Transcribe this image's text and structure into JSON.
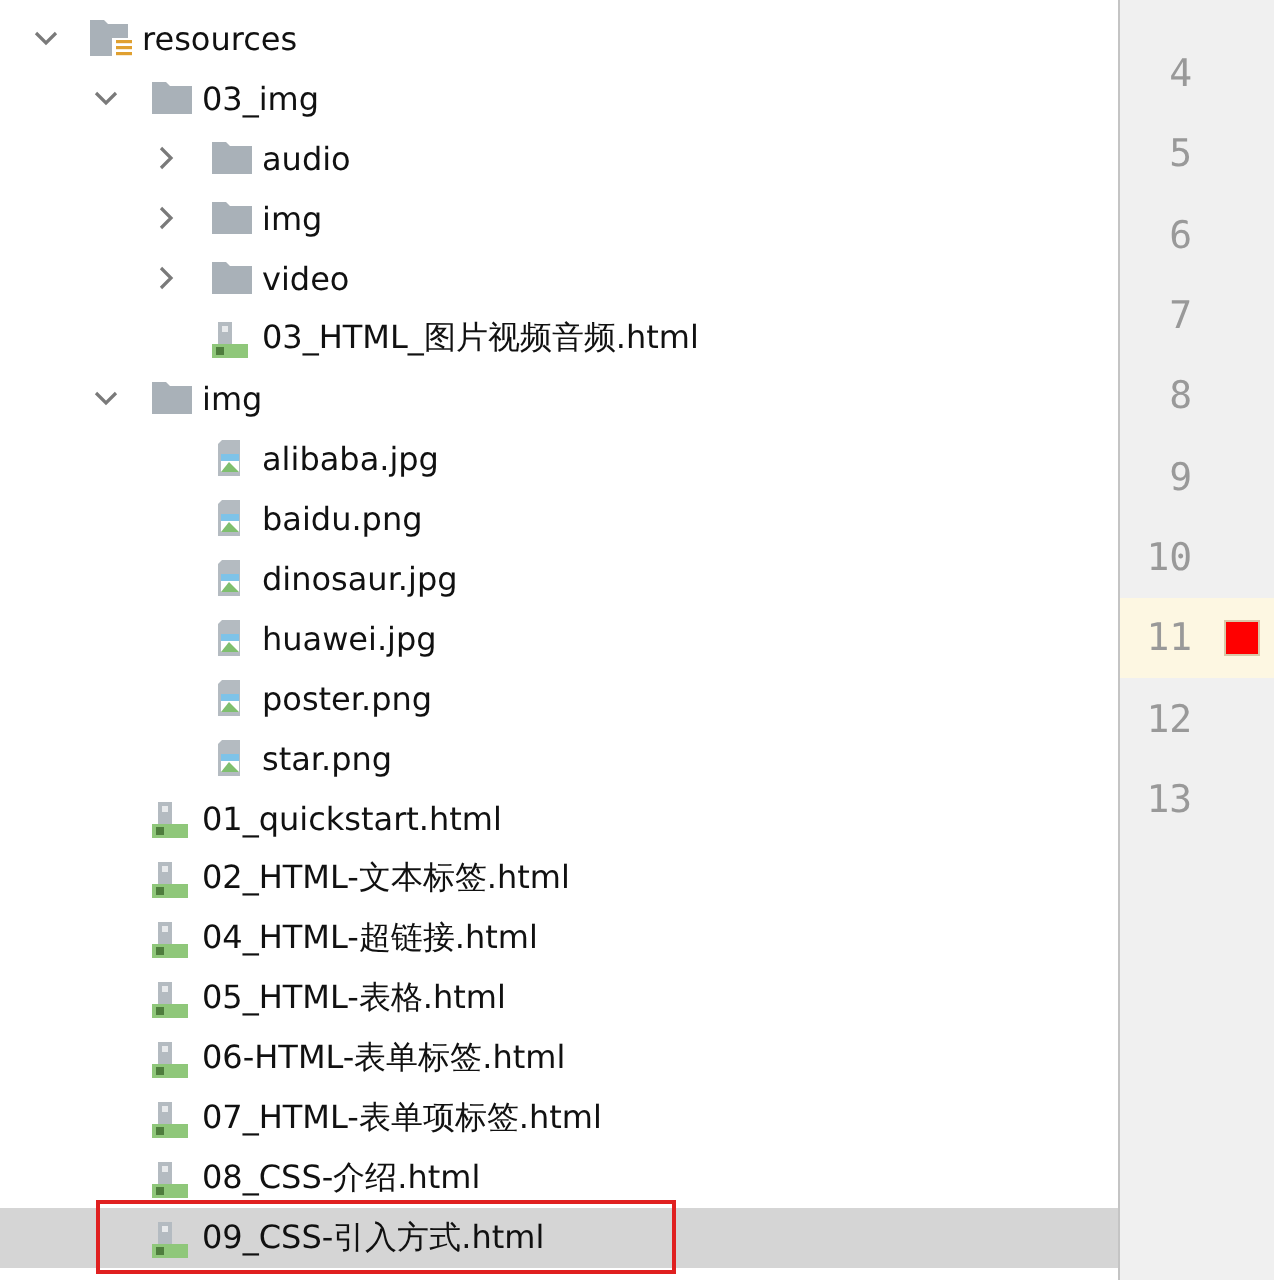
{
  "tree": [
    {
      "name": "resources",
      "kind": "module",
      "expanded": true,
      "selected": false,
      "children": [
        {
          "name": "03_img",
          "kind": "folder",
          "expanded": true,
          "selected": false,
          "children": [
            {
              "name": "audio",
              "kind": "folder",
              "expanded": false,
              "selected": false
            },
            {
              "name": "img",
              "kind": "folder",
              "expanded": false,
              "selected": false
            },
            {
              "name": "video",
              "kind": "folder",
              "expanded": false,
              "selected": false
            },
            {
              "name": "03_HTML_图片视频音频.html",
              "kind": "html",
              "selected": false
            }
          ]
        },
        {
          "name": "img",
          "kind": "folder",
          "expanded": true,
          "selected": false,
          "children": [
            {
              "name": "alibaba.jpg",
              "kind": "image",
              "selected": false
            },
            {
              "name": "baidu.png",
              "kind": "image",
              "selected": false
            },
            {
              "name": "dinosaur.jpg",
              "kind": "image",
              "selected": false
            },
            {
              "name": "huawei.jpg",
              "kind": "image",
              "selected": false
            },
            {
              "name": "poster.png",
              "kind": "image",
              "selected": false
            },
            {
              "name": "star.png",
              "kind": "image",
              "selected": false
            }
          ]
        },
        {
          "name": "01_quickstart.html",
          "kind": "html",
          "selected": false
        },
        {
          "name": "02_HTML-文本标签.html",
          "kind": "html",
          "selected": false
        },
        {
          "name": "04_HTML-超链接.html",
          "kind": "html",
          "selected": false
        },
        {
          "name": "05_HTML-表格.html",
          "kind": "html",
          "selected": false
        },
        {
          "name": "06-HTML-表单标签.html",
          "kind": "html",
          "selected": false
        },
        {
          "name": "07_HTML-表单项标签.html",
          "kind": "html",
          "selected": false
        },
        {
          "name": "08_CSS-介绍.html",
          "kind": "html",
          "selected": false
        },
        {
          "name": "09_CSS-引入方式.html",
          "kind": "html",
          "selected": true
        }
      ]
    }
  ],
  "gutter": {
    "lines": [
      {
        "number": "4",
        "current": false,
        "breakpoint": false
      },
      {
        "number": "5",
        "current": false,
        "breakpoint": false
      },
      {
        "number": "6",
        "current": false,
        "breakpoint": false
      },
      {
        "number": "7",
        "current": false,
        "breakpoint": false
      },
      {
        "number": "8",
        "current": false,
        "breakpoint": false
      },
      {
        "number": "9",
        "current": false,
        "breakpoint": false
      },
      {
        "number": "10",
        "current": false,
        "breakpoint": false
      },
      {
        "number": "11",
        "current": true,
        "breakpoint": true
      },
      {
        "number": "12",
        "current": false,
        "breakpoint": false
      },
      {
        "number": "13",
        "current": false,
        "breakpoint": false
      }
    ]
  }
}
